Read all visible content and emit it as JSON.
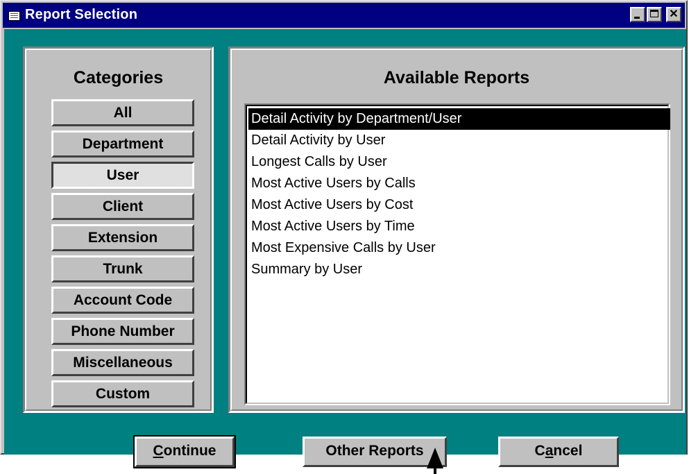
{
  "window": {
    "title": "Report Selection"
  },
  "titlebar_buttons": {
    "minimize": "_",
    "maximize": "□",
    "close": "✕"
  },
  "categories": {
    "heading": "Categories",
    "items": [
      {
        "label": "All",
        "pressed": false
      },
      {
        "label": "Department",
        "pressed": false
      },
      {
        "label": "User",
        "pressed": true
      },
      {
        "label": "Client",
        "pressed": false
      },
      {
        "label": "Extension",
        "pressed": false
      },
      {
        "label": "Trunk",
        "pressed": false
      },
      {
        "label": "Account Code",
        "pressed": false
      },
      {
        "label": "Phone Number",
        "pressed": false
      },
      {
        "label": "Miscellaneous",
        "pressed": false
      },
      {
        "label": "Custom",
        "pressed": false
      }
    ]
  },
  "reports": {
    "heading": "Available Reports",
    "selected_index": 0,
    "items": [
      "Detail Activity by Department/User",
      "Detail Activity by User",
      "Longest Calls by User",
      "Most Active Users by Calls",
      "Most Active Users by Cost",
      "Most Active Users by Time",
      "Most Expensive Calls by User",
      "Summary by User"
    ]
  },
  "buttons": {
    "continue": {
      "mnemonic": "C",
      "rest": "ontinue"
    },
    "other_reports": "Other Reports",
    "cancel": {
      "before": "C",
      "mnemonic": "a",
      "rest": "ncel"
    }
  }
}
